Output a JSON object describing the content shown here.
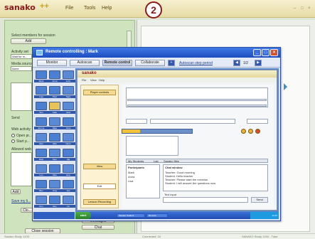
{
  "app": {
    "brand": "sanako",
    "menu": [
      "File",
      "Tools",
      "Help"
    ],
    "step_badge": "2",
    "window_controls": [
      "–",
      "□",
      "×"
    ]
  },
  "left_panel": {
    "select_members_label": "Select members for session",
    "add_label": "Add",
    "activity_label": "Activity set",
    "activity_value": "Wait for m...",
    "media_label": "Media source",
    "media_value": "None",
    "send_label": "Send",
    "web_label": "Web activity",
    "open_label": "Open pr...",
    "start_label": "Start p...",
    "allowed_label": "Allowed web...",
    "add2_label": "Add",
    "save_label": "Save my li...",
    "close_label": "Clo...",
    "messages_label": "Messages",
    "chat_label": "Chat",
    "close_session_label": "Close session"
  },
  "remote_window": {
    "title": "Remote controlling : Mark",
    "tabs": [
      "Monitor",
      "Autoscan",
      "Remote control",
      "Collaborate"
    ],
    "autoscan_label": "Autoscan step period",
    "page_indicator": "1/2",
    "thumbnails": [
      {
        "label": "Mark",
        "color": "#4b7fd1"
      },
      {
        "label": "Anna",
        "color": "#4b7fd1"
      },
      {
        "label": "John",
        "color": "#5a8ad6"
      },
      {
        "label": "Lisa",
        "color": "#4b7fd1"
      },
      {
        "label": "Paul",
        "color": "#4b7fd1"
      },
      {
        "label": "Sara",
        "color": "#5a8ad6"
      },
      {
        "label": "Tom",
        "color": "#4b7fd1"
      },
      {
        "label": "Kate",
        "color": "#e7c45a"
      },
      {
        "label": "Jack",
        "color": "#5a8ad6"
      },
      {
        "label": "Emma",
        "color": "#4b7fd1"
      },
      {
        "label": "Mike",
        "color": "#5a8ad6"
      },
      {
        "label": "Nora",
        "color": "#4b7fd1"
      },
      {
        "label": "Alex",
        "color": "#5a8ad6"
      },
      {
        "label": "Ella",
        "color": "#4b7fd1"
      },
      {
        "label": "Dave",
        "color": "#5a8ad6"
      },
      {
        "label": "Ruth",
        "color": "#4b7fd1"
      },
      {
        "label": "Sam",
        "color": "#5a8ad6"
      },
      {
        "label": "Ida",
        "color": "#4b7fd1"
      },
      {
        "label": "Leo",
        "color": "#5a8ad6"
      },
      {
        "label": "Max",
        "color": "#4b7fd1"
      },
      {
        "label": "Eva",
        "color": "#5a8ad6"
      },
      {
        "label": "Ben",
        "color": "#4b7fd1"
      },
      {
        "label": "Amy",
        "color": "#5a8ad6"
      },
      {
        "label": "Joe",
        "color": "#4b7fd1"
      },
      {
        "label": "Kim",
        "color": "#5a8ad6"
      },
      {
        "label": "Roy",
        "color": "#4b7fd1"
      },
      {
        "label": "Liv",
        "color": "#5a8ad6"
      }
    ]
  },
  "inner_app": {
    "brand": "sanako",
    "menu": [
      "File",
      "View",
      "Help"
    ],
    "player_button": "Player controls",
    "view_button": "View",
    "exit_button": "Exit",
    "record_button": "Lesson Recording",
    "progress": 0.25,
    "participants_label": "Participants",
    "participants": [
      "Mark",
      "Anna",
      "Lisa"
    ],
    "chat_label": "Chat window",
    "chat_lines": [
      "Teacher: Good morning",
      "Student: Hello teacher",
      "Teacher: Please start the exercise",
      "Student: I will answer the questions now"
    ],
    "send_button": "Send",
    "text_label": "Text input",
    "tabs": [
      "My Students",
      "Lab",
      "Sanako files"
    ]
  },
  "inner_taskbar": {
    "start": "start",
    "items": [
      "Sanako Student",
      "Remote"
    ],
    "clock": "10:45"
  },
  "status": {
    "left": "Sanako Study 1200",
    "center": "Connected: 24",
    "right": "SANAKO Study 1200 - Tutor"
  },
  "colors": {
    "brand": "#8a1b1b",
    "panel_green": "#cfe3bf",
    "titlebar_blue": "#1d4cbf"
  }
}
